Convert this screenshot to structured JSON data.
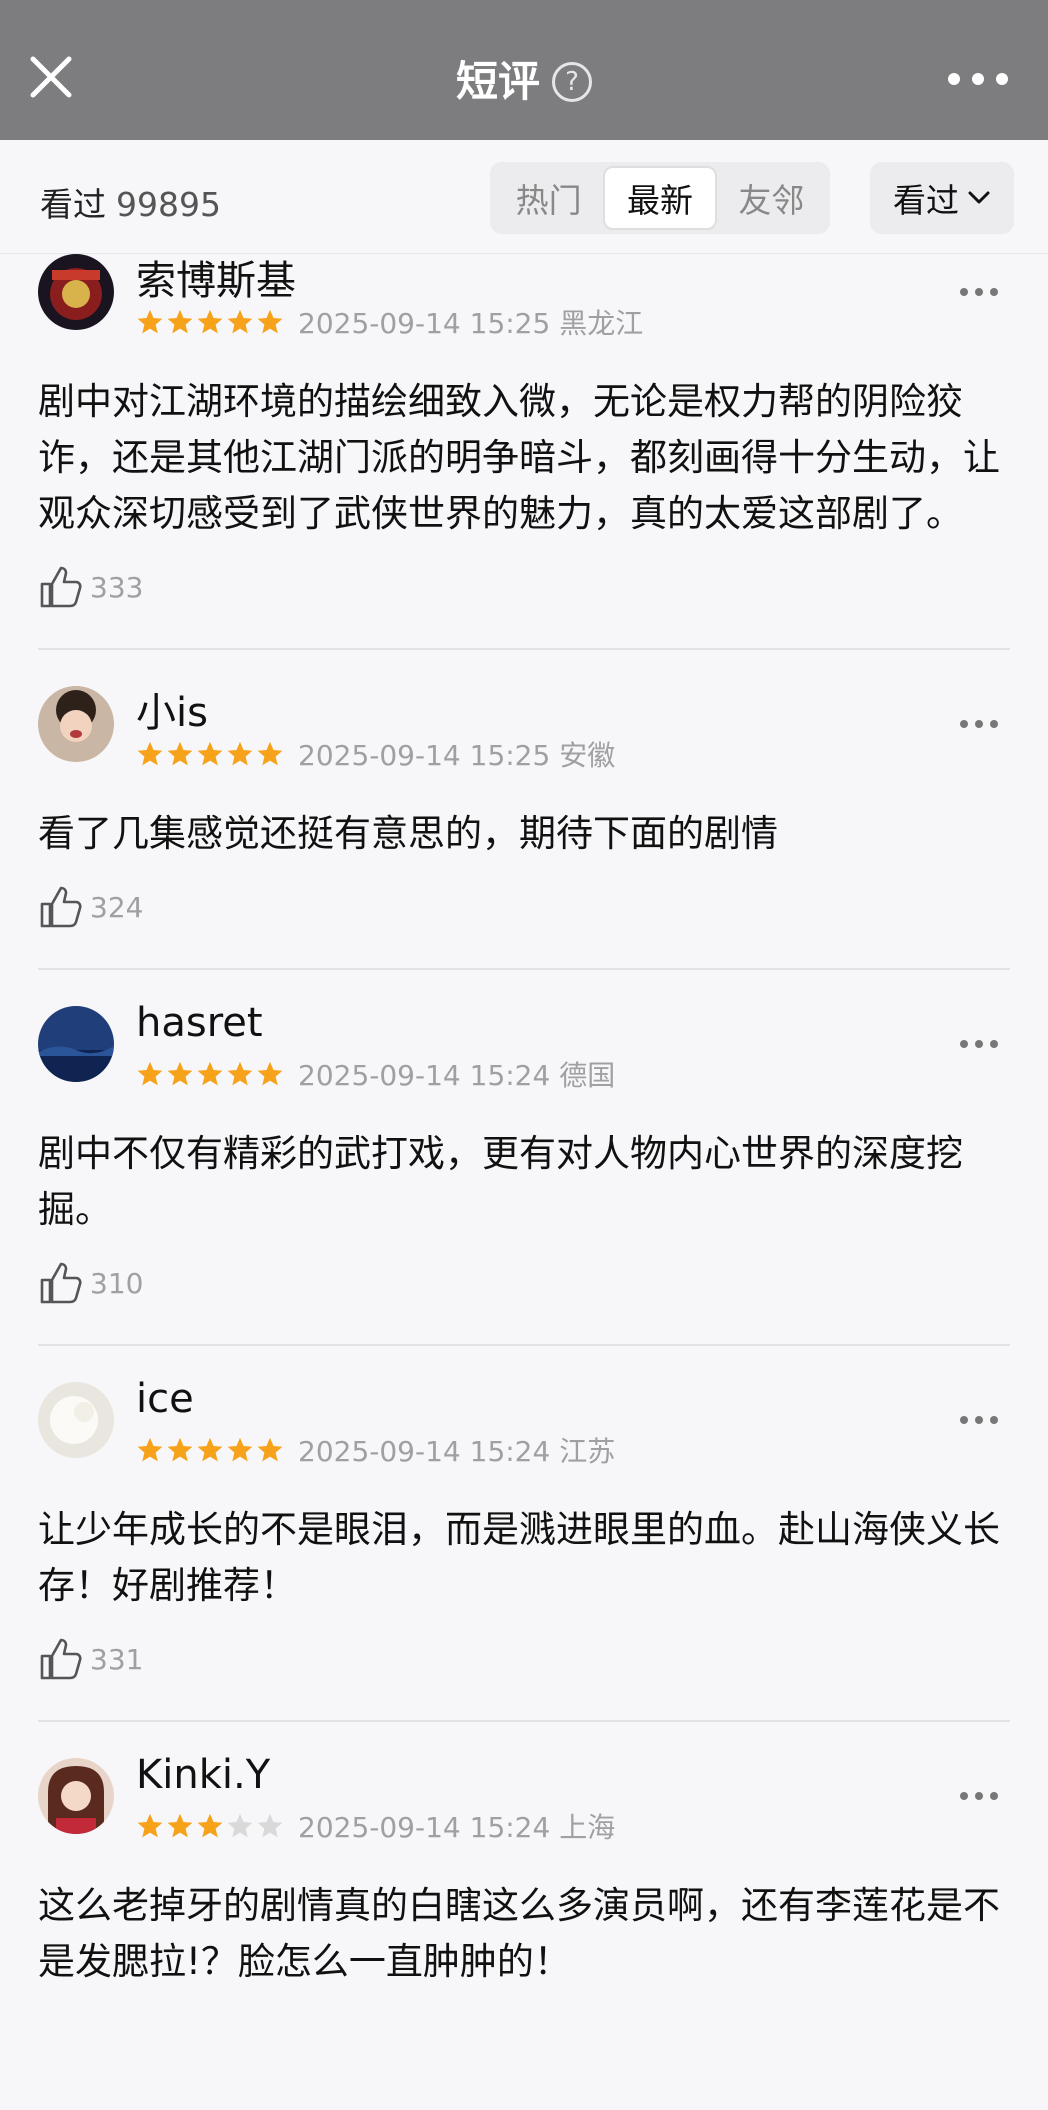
{
  "header": {
    "title": "短评",
    "help_glyph": "?",
    "close_icon": "close-icon",
    "more_icon": "more-icon"
  },
  "filter": {
    "watched_label": "看过",
    "watched_count": "99895",
    "tabs": [
      {
        "label": "热门",
        "active": false
      },
      {
        "label": "最新",
        "active": true
      },
      {
        "label": "友邻",
        "active": false
      }
    ],
    "dropdown_label": "看过"
  },
  "colors": {
    "header_bg": "#7d7d7f",
    "star_on": "#f7a21b",
    "star_off": "#d9d9d9"
  },
  "comments": [
    {
      "username": "索博斯基",
      "rating": 5,
      "time": "2025-09-14 15:25",
      "location": "黑龙江",
      "text": "剧中对江湖环境的描绘细致入微，无论是权力帮的阴险狡诈，还是其他江湖门派的明争暗斗，都刻画得十分生动，让观众深切感受到了武侠世界的魅力，真的太爱这部剧了。",
      "likes": "333"
    },
    {
      "username": "小is",
      "rating": 5,
      "time": "2025-09-14 15:25",
      "location": "安徽",
      "text": "看了几集感觉还挺有意思的，期待下面的剧情",
      "likes": "324"
    },
    {
      "username": "hasret",
      "rating": 5,
      "time": "2025-09-14 15:24",
      "location": "德国",
      "text": "剧中不仅有精彩的武打戏，更有对人物内心世界的深度挖掘。",
      "likes": "310"
    },
    {
      "username": "ice",
      "rating": 5,
      "time": "2025-09-14 15:24",
      "location": "江苏",
      "text": "让少年成长的不是眼泪，而是溅进眼里的血。赴山海侠义长存！好剧推荐！",
      "likes": "331"
    },
    {
      "username": "Kinki.Y",
      "rating": 3,
      "time": "2025-09-14 15:24",
      "location": "上海",
      "text": "这么老掉牙的剧情真的白瞎这么多演员啊，还有李莲花是不是发腮拉!？脸怎么一直肿肿的！",
      "likes": ""
    }
  ]
}
